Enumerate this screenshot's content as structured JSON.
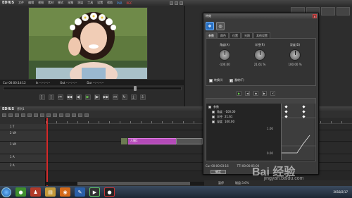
{
  "player": {
    "app_name": "EDIUS",
    "menu": [
      "文件",
      "编辑",
      "视图",
      "素材",
      "模式",
      "采集",
      "渲染",
      "工具",
      "设置",
      "帮助"
    ],
    "plr_badge": "PLR",
    "rec_badge": "REC",
    "timecode": {
      "cur": "Cur 00:00:14:12",
      "in": "In --:--:--:--",
      "out": "Out --:--:--:--",
      "dur": "Dur --:--:--:--"
    }
  },
  "dialog": {
    "title": "特效",
    "tabs": [
      "参数",
      "颜色",
      "位置",
      "光照",
      "其他设置"
    ],
    "knobs": [
      {
        "label": "角度(A)",
        "value": "-100.00"
      },
      {
        "label": "半径(R)",
        "value": "21.61 %"
      },
      {
        "label": "深度(D)",
        "value": "100.00 %"
      }
    ],
    "checkboxes": [
      {
        "label": "转换(I)",
        "checked": false
      },
      {
        "label": "翻转(F)",
        "checked": true
      }
    ],
    "keyframe_rows": [
      {
        "label": "参数",
        "value": ""
      },
      {
        "label": "角度",
        "value": "-100.00"
      },
      {
        "label": "半径",
        "value": "21.61"
      },
      {
        "label": "深度",
        "value": "100.00"
      }
    ],
    "kf_scale_top": "1.00",
    "kf_scale_bottom": "0.00",
    "bottom_cur": "Cur 00:00:03:16",
    "bottom_ttl": "TTl 00:00:05:00",
    "ok_label": "确定"
  },
  "timeline": {
    "app_name": "EDIUS",
    "sequence": "序列1",
    "tracks": [
      {
        "label": "1 T",
        "height": "small"
      },
      {
        "label": "2 VA",
        "height": "large"
      },
      {
        "label": "1 VA",
        "height": "large"
      },
      {
        "label": "1 A",
        "height": "small"
      },
      {
        "label": "2 A",
        "height": "small"
      }
    ],
    "clip_label": "人物1",
    "status_left": "暂停",
    "status_right": "磁盘:3.6%"
  },
  "taskbar": {
    "time": "",
    "date": "2018/2/17"
  },
  "watermark": {
    "logo": "Bai 经验",
    "url": "jingyan.baidu.com"
  }
}
